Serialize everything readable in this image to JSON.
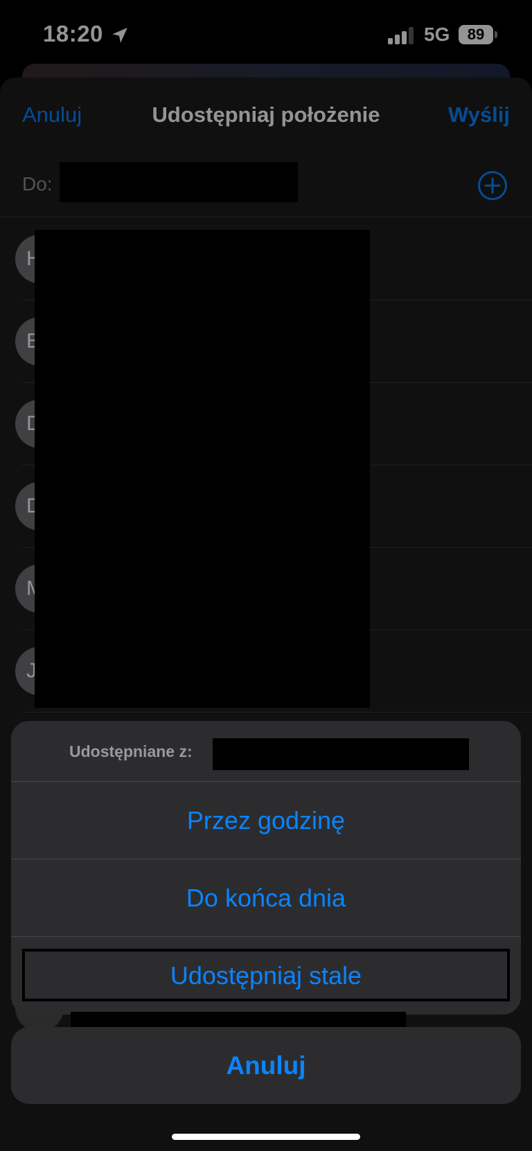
{
  "status_bar": {
    "time": "18:20",
    "network": "5G",
    "battery": "89",
    "location_icon": "location-arrow-icon",
    "signal_icon": "cellular-signal-icon"
  },
  "nav": {
    "cancel_label": "Anuluj",
    "title": "Udostępniaj położenie",
    "send_label": "Wyślij"
  },
  "to_row": {
    "label": "Do:",
    "add_icon": "plus-circle-icon"
  },
  "contacts": [
    {
      "initial": "H"
    },
    {
      "initial": "B"
    },
    {
      "initial": "D"
    },
    {
      "initial": "D"
    },
    {
      "initial": "M"
    },
    {
      "initial": "J"
    }
  ],
  "action_sheet": {
    "header_label": "Udostępniane z:",
    "options": [
      {
        "label": "Przez godzinę"
      },
      {
        "label": "Do końca dnia"
      },
      {
        "label": "Udostępniaj stale"
      }
    ],
    "cancel_label": "Anuluj"
  },
  "colors": {
    "accent": "#0a84ff",
    "sheet_bg": "#1c1c1e",
    "action_bg": "#2c2c2e"
  }
}
